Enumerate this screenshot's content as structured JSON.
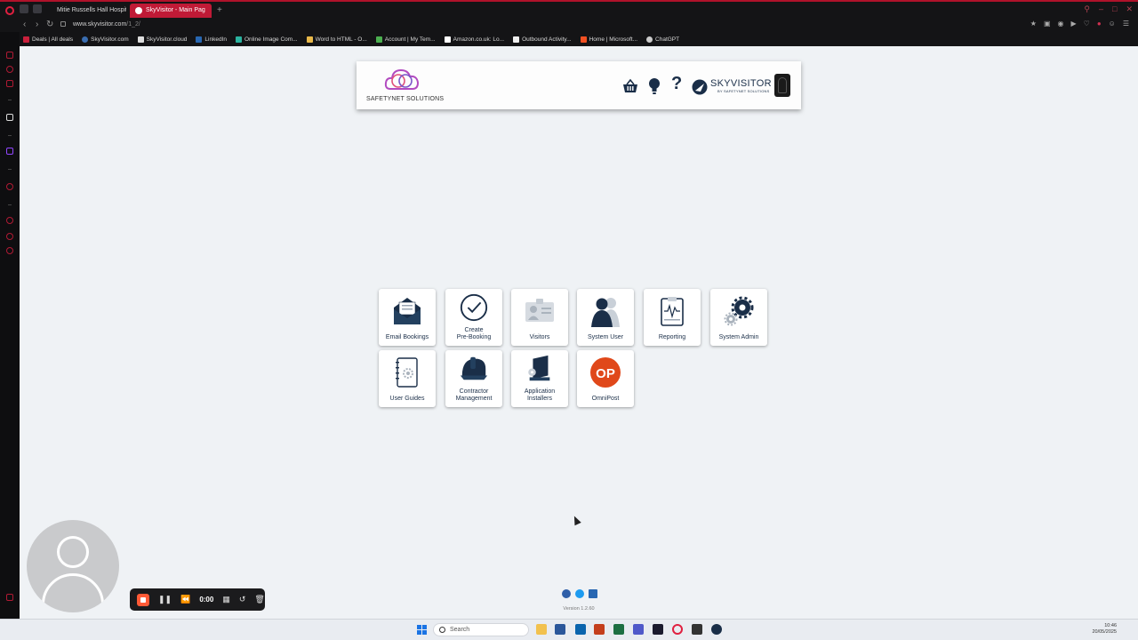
{
  "browser": {
    "tabs": [
      {
        "label": "Mitie Russells Hall Hospit"
      },
      {
        "label": "SkyVisitor - Main Pag"
      }
    ],
    "new_tab": "+",
    "url_domain": "www.skyvisitor.com",
    "url_path": "/1_2/",
    "bookmarks": [
      {
        "label": "Deals | All deals"
      },
      {
        "label": "SkyVisitor.com"
      },
      {
        "label": "SkyVisitor.cloud"
      },
      {
        "label": "LinkedIn"
      },
      {
        "label": "Online Image Com..."
      },
      {
        "label": "Word to HTML - O..."
      },
      {
        "label": "Account | My Tem..."
      },
      {
        "label": "Amazon.co.uk: Lo..."
      },
      {
        "label": "Outbound Activity..."
      },
      {
        "label": "Home | Microsoft..."
      },
      {
        "label": "ChatGPT"
      }
    ],
    "accent_color": "#c01a36"
  },
  "header": {
    "company": "SAFETYNET SOLUTIONS",
    "brand": "SKYVISITOR",
    "brand_sub": "BY SAFETYNET SOLUTIONS",
    "help_symbol": "?"
  },
  "tiles": [
    {
      "label": "Email Bookings",
      "icon": "envelope-icon"
    },
    {
      "label": "Create Pre-Booking",
      "icon": "clock-icon"
    },
    {
      "label": "Visitors",
      "icon": "id-card-icon"
    },
    {
      "label": "System User",
      "icon": "users-icon"
    },
    {
      "label": "Reporting",
      "icon": "clipboard-chart-icon"
    },
    {
      "label": "System Admin",
      "icon": "gears-icon"
    },
    {
      "label": "User Guides",
      "icon": "notebook-icon"
    },
    {
      "label": "Contractor Management",
      "icon": "hard-hat-icon"
    },
    {
      "label": "Application Installers",
      "icon": "installer-icon"
    },
    {
      "label": "OmniPost",
      "icon": "omnipost-logo",
      "logo_text": "OP"
    }
  ],
  "tile_lines": {
    "create_1": "Create",
    "create_2": "Pre-Booking",
    "contractor_1": "Contractor",
    "contractor_2": "Management",
    "installers_1": "Application",
    "installers_2": "Installers"
  },
  "footer": {
    "version": "Version 1.2.60"
  },
  "recorder": {
    "time": "0:00"
  },
  "taskbar": {
    "search_placeholder": "Search",
    "time": "10:46",
    "date": "20/05/2025"
  }
}
